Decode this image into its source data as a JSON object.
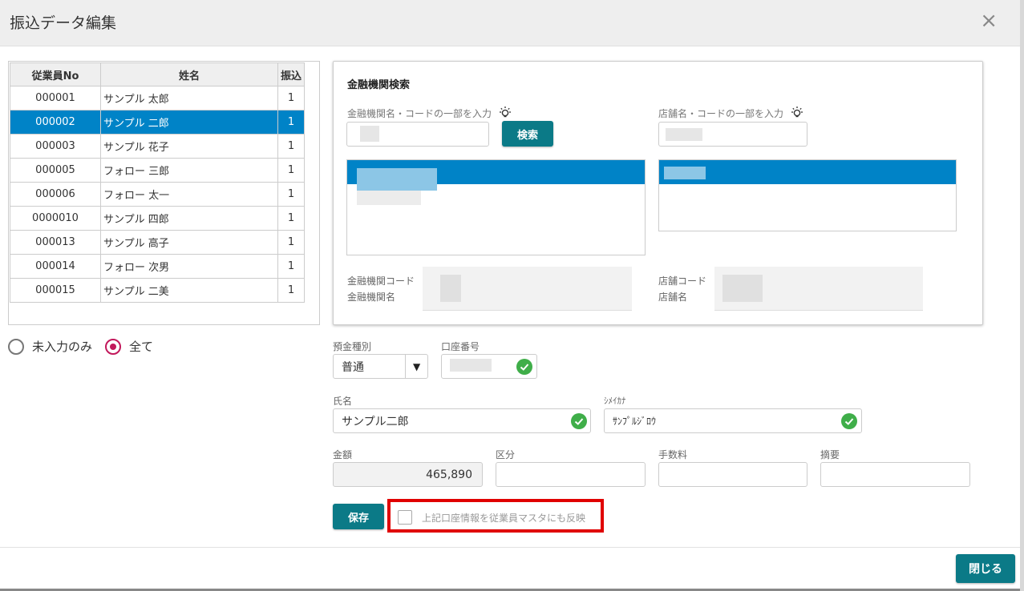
{
  "dialog": {
    "title": "振込データ編集",
    "close_glyph": "×"
  },
  "employee_table": {
    "headers": [
      "従業員No",
      "姓名",
      "振込"
    ],
    "rows": [
      {
        "no": "000001",
        "name": "サンプル 太郎",
        "count": "1"
      },
      {
        "no": "000002",
        "name": "サンプル 二郎",
        "count": "1",
        "selected": true
      },
      {
        "no": "000003",
        "name": "サンプル 花子",
        "count": "1"
      },
      {
        "no": "000005",
        "name": "フォロー 三郎",
        "count": "1"
      },
      {
        "no": "000006",
        "name": "フォロー 太一",
        "count": "1"
      },
      {
        "no": "0000010",
        "name": "サンプル 四郎",
        "count": "1"
      },
      {
        "no": "000013",
        "name": "サンプル 高子",
        "count": "1"
      },
      {
        "no": "000014",
        "name": "フォロー 次男",
        "count": "1"
      },
      {
        "no": "000015",
        "name": "サンプル 二美",
        "count": "1"
      }
    ]
  },
  "filter": {
    "option_unentered": "未入力のみ",
    "option_all": "全て",
    "selected": "all"
  },
  "bank_search": {
    "title": "金融機関検索",
    "bank_hint": "金融機関名・コードの一部を入力",
    "branch_hint": "店舗名・コードの一部を入力",
    "search_button": "検索",
    "bank_code_label": "金融機関コード",
    "bank_name_label": "金融機関名",
    "branch_code_label": "店舗コード",
    "branch_name_label": "店舗名"
  },
  "form": {
    "deposit_type_label": "預金種別",
    "deposit_type_value": "普通",
    "deposit_type_arrow": "▼",
    "account_no_label": "口座番号",
    "name_label": "氏名",
    "name_value": "サンプル二郎",
    "kana_label": "ｼﾒｲｶﾅ",
    "kana_value": "ｻﾝﾌﾟﾙｼﾞﾛｳ",
    "amount_label": "金額",
    "amount_value": "465,890",
    "category_label": "区分",
    "fee_label": "手数料",
    "memo_label": "摘要",
    "save_button": "保存",
    "reflect_checkbox_label": "上記口座情報を従業員マスタにも反映",
    "reflect_checked": false
  },
  "footer": {
    "close_button": "閉じる"
  },
  "colors": {
    "accent": "#0b7a87",
    "selection": "#0083c7",
    "radio": "#c2185b",
    "valid": "#3fae49",
    "highlight": "#e00000"
  }
}
